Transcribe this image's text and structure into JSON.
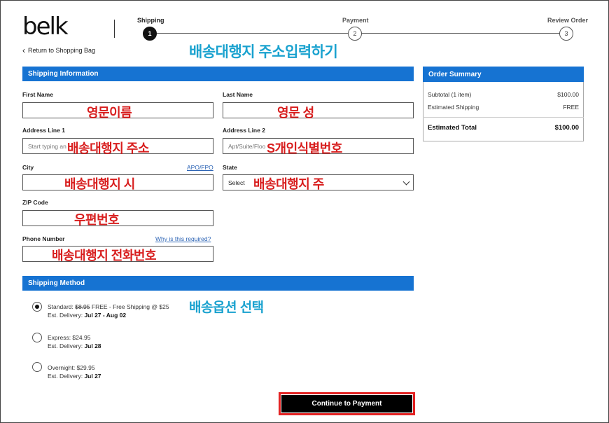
{
  "header": {
    "logo": "belk",
    "return_link": "Return to Shopping Bag",
    "overlay_title": "배송대행지 주소입력하기"
  },
  "steps": [
    {
      "label": "Shipping",
      "number": "1",
      "active": true
    },
    {
      "label": "Payment",
      "number": "2",
      "active": false
    },
    {
      "label": "Review Order",
      "number": "3",
      "active": false
    }
  ],
  "shipping_info": {
    "title": "Shipping Information",
    "first_name": {
      "label": "First Name",
      "annotation": "영문이름"
    },
    "last_name": {
      "label": "Last Name",
      "annotation": "영문 성"
    },
    "address1": {
      "label": "Address Line 1",
      "placeholder": "Start typing an",
      "annotation": "배송대행지 주소"
    },
    "address2": {
      "label": "Address Line 2",
      "placeholder": "Apt/Suite/Floo",
      "annotation": "S개인식별번호"
    },
    "city": {
      "label": "City",
      "link": "APO/FPO",
      "annotation": "배송대행지 시"
    },
    "state": {
      "label": "State",
      "value": "Select",
      "annotation": "배송대행지 주"
    },
    "zip": {
      "label": "ZIP Code",
      "annotation": "우편번호"
    },
    "phone": {
      "label": "Phone Number",
      "link": "Why is this required?",
      "annotation": "배송대행지 전화번호"
    }
  },
  "shipping_method": {
    "title": "Shipping Method",
    "annotation": "배송옵션 선택",
    "options": [
      {
        "prefix": "Standard: ",
        "old_price": "$8.95",
        "suffix": " FREE - Free Shipping @ $25",
        "delivery_label": "Est. Delivery: ",
        "delivery_date": "Jul 27 - Aug 02",
        "selected": true
      },
      {
        "prefix": "Express: $24.95",
        "old_price": "",
        "suffix": "",
        "delivery_label": "Est. Delivery: ",
        "delivery_date": "Jul 28",
        "selected": false
      },
      {
        "prefix": "Overnight: $29.95",
        "old_price": "",
        "suffix": "",
        "delivery_label": "Est. Delivery: ",
        "delivery_date": "Jul 27",
        "selected": false
      }
    ]
  },
  "continue_button": "Continue to Payment",
  "order_summary": {
    "title": "Order Summary",
    "subtotal_label": "Subtotal (1 item)",
    "subtotal_value": "$100.00",
    "shipping_label": "Estimated Shipping",
    "shipping_value": "FREE",
    "total_label": "Estimated Total",
    "total_value": "$100.00"
  },
  "colors": {
    "section_blue": "#1673d2",
    "annotation_red": "#d81e1e",
    "annotation_cyan": "#1aa2cf",
    "highlight_red": "#e32222"
  }
}
